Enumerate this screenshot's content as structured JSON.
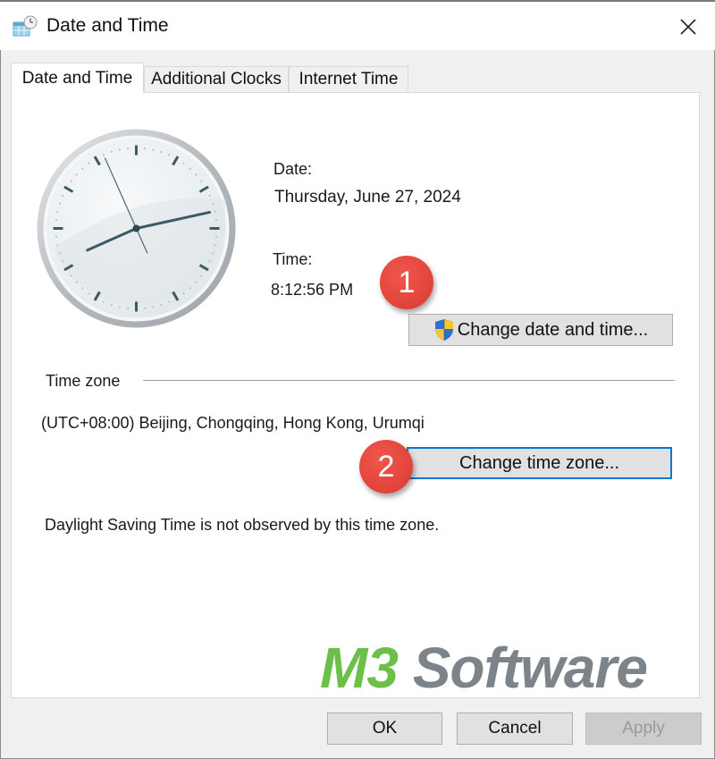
{
  "window": {
    "title": "Date and Time",
    "app_icon": "calendar-clock-icon",
    "close_icon": "close-icon"
  },
  "tabs": [
    {
      "label": "Date and Time",
      "active": true
    },
    {
      "label": "Additional Clocks",
      "active": false
    },
    {
      "label": "Internet Time",
      "active": false
    }
  ],
  "clock": {
    "hour": 8,
    "minute": 12,
    "second": 56
  },
  "date_section": {
    "date_label": "Date:",
    "date_value": "Thursday, June 27, 2024",
    "time_label": "Time:",
    "time_value": "8:12:56 PM",
    "change_button_label": "Change date and time...",
    "change_button_icon": "uac-shield-icon"
  },
  "timezone_section": {
    "group_label": "Time zone",
    "current_zone": "(UTC+08:00) Beijing, Chongqing, Hong Kong, Urumqi",
    "change_button_label": "Change time zone...",
    "dst_note": "Daylight Saving Time is not observed by this time zone."
  },
  "annotations": [
    {
      "number": "1",
      "color": "#e8463d"
    },
    {
      "number": "2",
      "color": "#e8463d"
    }
  ],
  "watermark": {
    "part1": "M3",
    "part2": " Software",
    "part1_color": "#6cc04a",
    "part2_color": "#7d8489"
  },
  "footer": {
    "ok_label": "OK",
    "cancel_label": "Cancel",
    "apply_label": "Apply",
    "apply_enabled": false
  }
}
